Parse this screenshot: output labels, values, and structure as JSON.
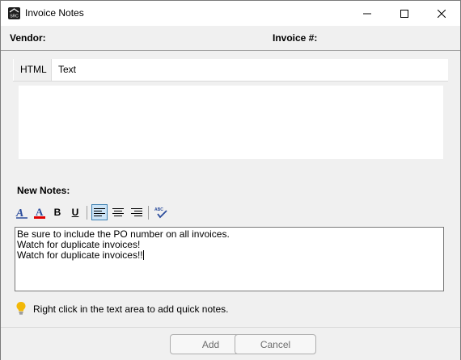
{
  "window": {
    "title": "Invoice Notes",
    "app_icon_text": "SRC"
  },
  "header": {
    "vendor_label": "Vendor:",
    "invoice_label": "Invoice #:"
  },
  "tabs": [
    {
      "label": "HTML",
      "selected": true
    },
    {
      "label": "Text",
      "selected": false
    }
  ],
  "new_notes": {
    "label": "New Notes:",
    "toolbar": {
      "font_style_icon": "font-style-icon",
      "font_color_icon": "font-color-icon",
      "bold_label": "B",
      "underline_label": "U",
      "spell_check_label": "ABC",
      "active_alignment": "left"
    },
    "lines": [
      "Be sure to include the PO number on all invoices.",
      "Watch for duplicate invoices!",
      "Watch for duplicate invoices!!"
    ]
  },
  "hint": {
    "icon": "lightbulb-icon",
    "text": "Right click in the text area to add quick notes."
  },
  "footer": {
    "add_label": "Add",
    "cancel_label": "Cancel"
  },
  "colors": {
    "accent": "#3c7fb1",
    "font_color_underline": "#e00000",
    "hint_icon": "#f2b807"
  }
}
